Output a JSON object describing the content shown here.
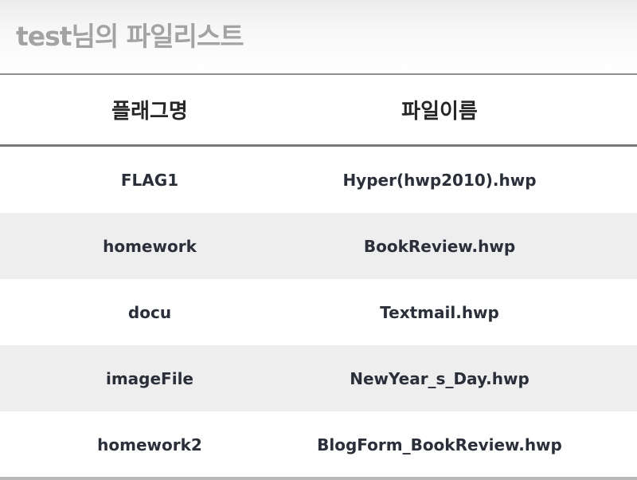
{
  "header": {
    "title": "test님의 파일리스트"
  },
  "table": {
    "columns": {
      "flag": "플래그명",
      "file": "파일이름"
    },
    "rows": [
      {
        "flag": "FLAG1",
        "file": "Hyper(hwp2010).hwp"
      },
      {
        "flag": "homework",
        "file": "BookReview.hwp"
      },
      {
        "flag": "docu",
        "file": "Textmail.hwp"
      },
      {
        "flag": "imageFile",
        "file": "NewYear_s_Day.hwp"
      },
      {
        "flag": "homework2",
        "file": "BlogForm_BookReview.hwp"
      }
    ]
  }
}
